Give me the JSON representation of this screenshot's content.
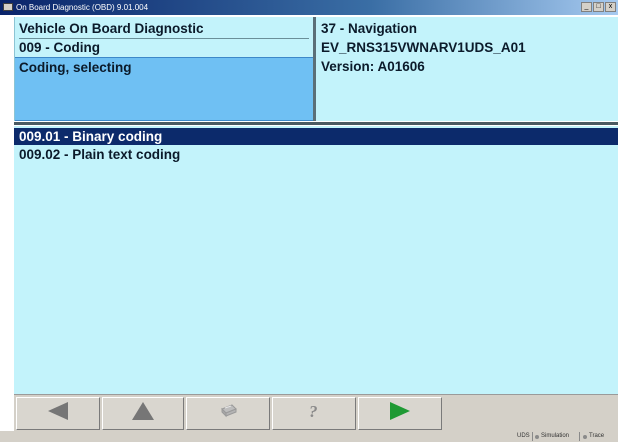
{
  "window": {
    "title": "On Board Diagnostic (OBD) 9.01.004",
    "controls": [
      "_",
      "□",
      "x"
    ]
  },
  "info_left": {
    "heading": "Vehicle On Board Diagnostic",
    "function": "009 - Coding",
    "current_step": "Coding, selecting"
  },
  "info_right": {
    "control_unit": "37 - Navigation",
    "part_id": "EV_RNS315VWNARV1UDS_A01",
    "version": "Version: A01606"
  },
  "list": {
    "items": [
      {
        "label": "009.01 - Binary coding",
        "selected": true
      },
      {
        "label": "009.02 - Plain text coding",
        "selected": false
      }
    ]
  },
  "toolbar": {
    "buttons": [
      {
        "icon": "back-arrow-icon",
        "enabled": true
      },
      {
        "icon": "up-arrow-icon",
        "enabled": true
      },
      {
        "icon": "print-icon",
        "enabled": false
      },
      {
        "icon": "help-question-icon",
        "enabled": false
      },
      {
        "icon": "forward-arrow-icon",
        "enabled": true
      }
    ]
  },
  "statusbar": {
    "protocol": "UDS",
    "simulation": "Simulation",
    "trace": "Trace"
  },
  "colors": {
    "panel_bg": "#c3f3fb",
    "selected_step_bg": "#6fc0f3",
    "list_selection_bg": "#0c2a6b",
    "forward_arrow": "#1f9a34",
    "nav_arrow": "#7a7a7a"
  }
}
